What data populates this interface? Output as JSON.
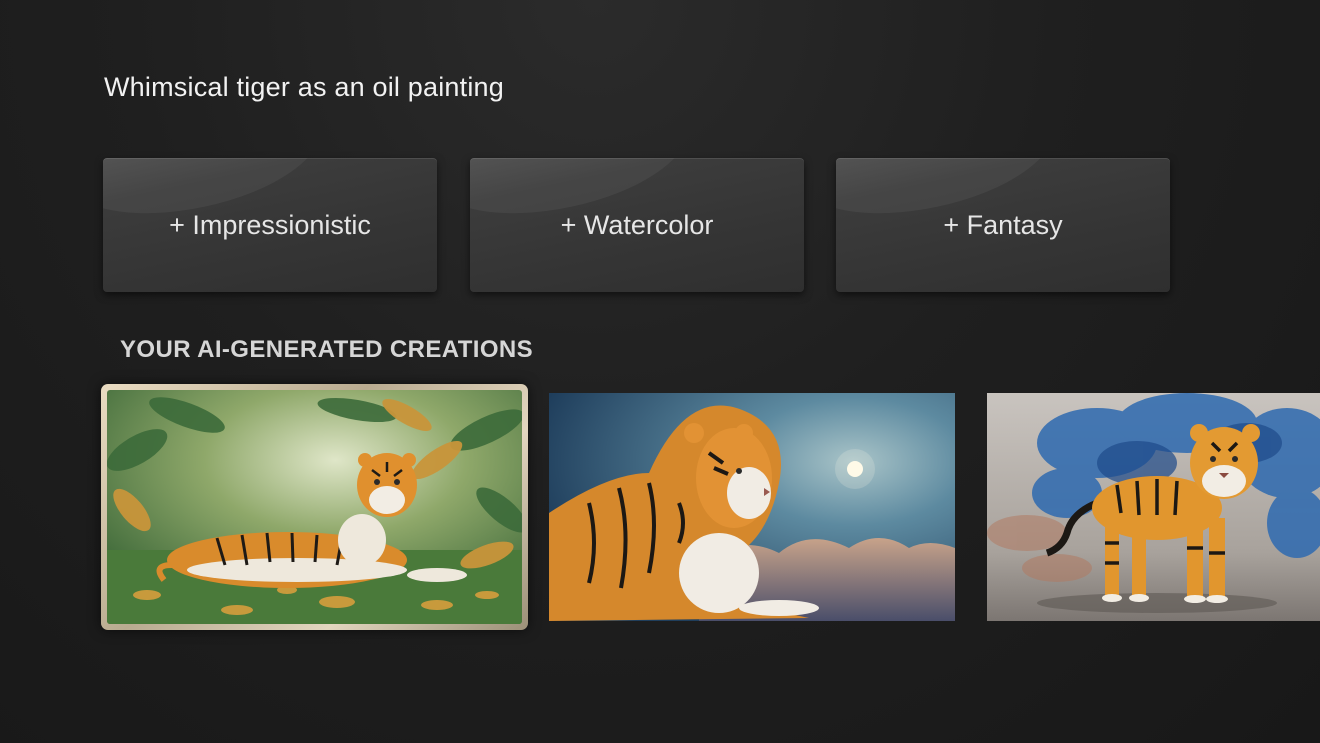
{
  "prompt": "Whimsical tiger as an oil painting",
  "chips": [
    "+ Impressionistic",
    "+ Watercolor",
    "+ Fantasy"
  ],
  "section_title": "YOUR AI-GENERATED CREATIONS",
  "creations": [
    {
      "subject": "tiger lying in jungle leaves",
      "focused": true
    },
    {
      "subject": "tiger with moon above clouds",
      "focused": false
    },
    {
      "subject": "tiger standing before blue smoke",
      "focused": false
    }
  ],
  "colors": {
    "background": "#1f1f1f",
    "chip": "#3a3a3a",
    "focus_frame": "#d9ccb2"
  }
}
